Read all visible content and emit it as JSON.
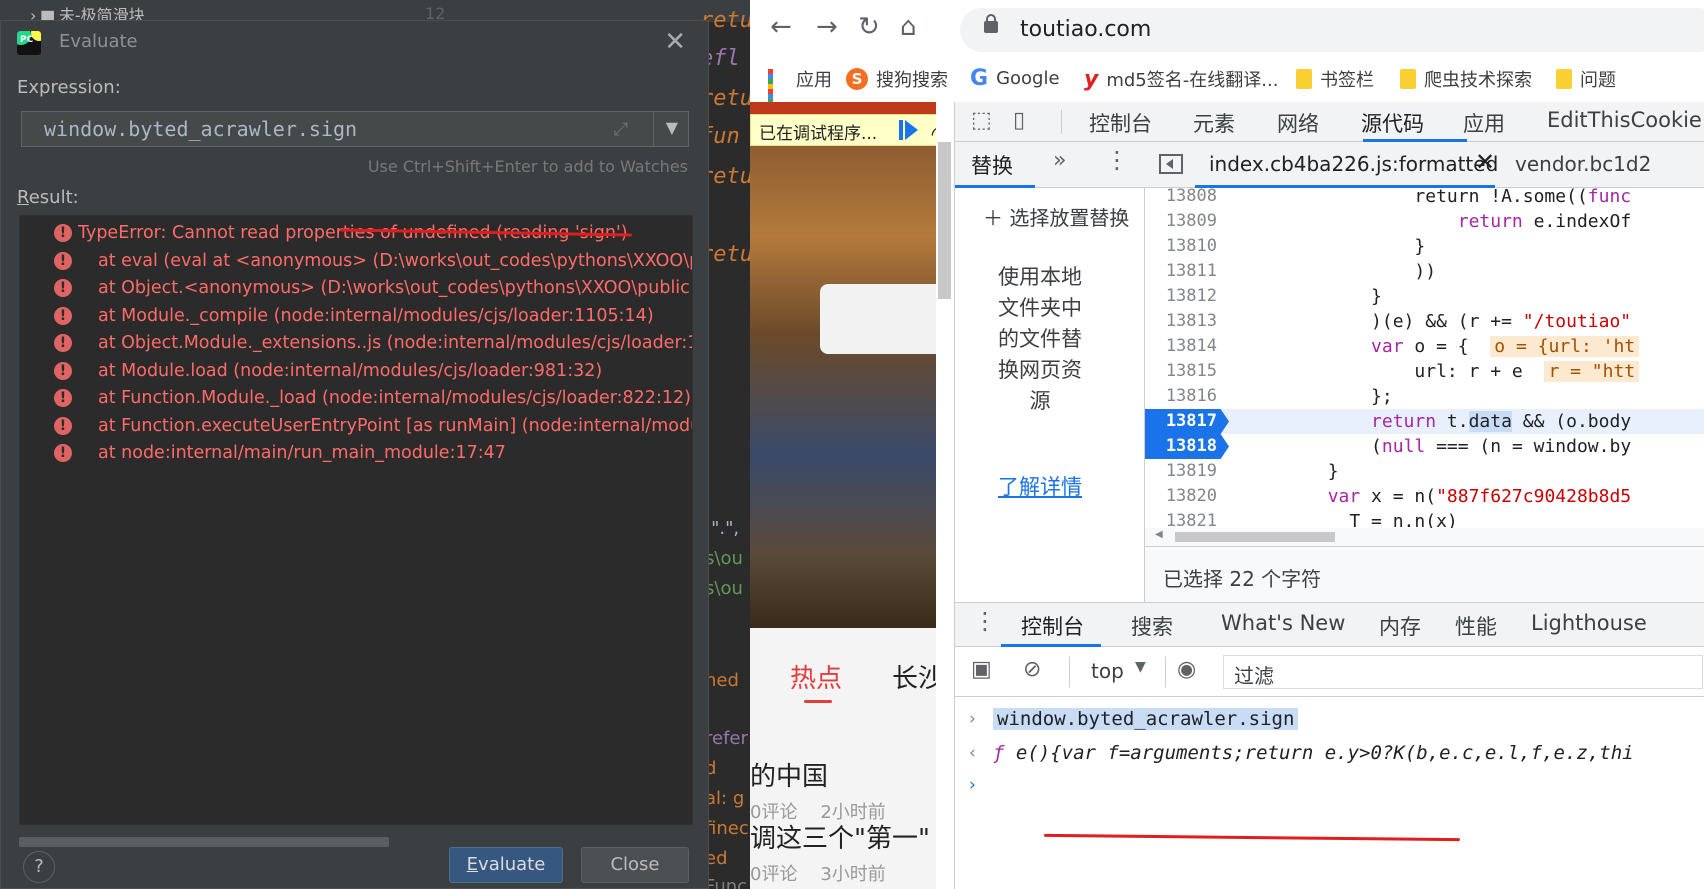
{
  "ide": {
    "tree_item": "未-极简滑块",
    "line_no": "12",
    "code_fragments": [
      "retu",
      "efl",
      "retu",
      "fun",
      "retu",
      "retu"
    ],
    "side_fragments": [
      ":\".\",",
      "s\\ou",
      "s\\ou",
      "ned",
      "refer",
      "d",
      "al: g",
      "finec",
      "ed",
      "Func"
    ]
  },
  "evaluate_dialog": {
    "title": "Evaluate",
    "logo_text": "PC",
    "expression_label": "Expression:",
    "expression_value": "window.byted_acrawler.sign",
    "watch_hint": "Use Ctrl+Shift+Enter to add to Watches",
    "result_label_first": "R",
    "result_label_rest": "esult:",
    "errors": [
      "TypeError: Cannot read properties of undefined (reading 'sign')",
      "at eval (eval at <anonymous> (D:\\works\\out_codes\\pythons\\XXOO\\p",
      "at Object.<anonymous> (D:\\works\\out_codes\\pythons\\XXOO\\public",
      "at Module._compile (node:internal/modules/cjs/loader:1105:14)",
      "at Object.Module._extensions..js (node:internal/modules/cjs/loader:1",
      "at Module.load (node:internal/modules/cjs/loader:981:32)",
      "at Function.Module._load (node:internal/modules/cjs/loader:822:12)",
      "at Function.executeUserEntryPoint [as runMain] (node:internal/modu",
      "at node:internal/main/run_main_module:17:47"
    ],
    "evaluate_label_first": "E",
    "evaluate_label_rest": "valuate",
    "close_label": "Close",
    "help_label": "?"
  },
  "browser": {
    "url": "toutiao.com",
    "bookmarks": [
      {
        "label": "应用",
        "icon": "apps-grid-icon"
      },
      {
        "label": "搜狗搜索",
        "icon": "sogou-icon"
      },
      {
        "label": "Google",
        "icon": "google-icon"
      },
      {
        "label": "md5签名-在线翻译...",
        "icon": "y-icon"
      },
      {
        "label": "书签栏",
        "icon": "folder-icon"
      },
      {
        "label": "爬虫技术探索",
        "icon": "folder-icon"
      },
      {
        "label": "问题",
        "icon": "folder-icon"
      }
    ],
    "page": {
      "debug_banner": "已在调试程序...",
      "tab_hot": "热点",
      "tab_second": "长沙",
      "news": [
        {
          "title": "调这三个\"第一\"",
          "comments": "0评论",
          "time": "3小时前"
        },
        {
          "title": "的中国",
          "comments": "0评论",
          "time": "2小时前"
        }
      ]
    }
  },
  "devtools": {
    "top_tabs": [
      "控制台",
      "元素",
      "网络",
      "源代码",
      "应用",
      "EditThisCookie"
    ],
    "active_top_tab": "源代码",
    "navigator": {
      "tab": "替换",
      "more": "»",
      "add_folder": "选择放置替换",
      "description": "使用本地文件夹中的文件替换网页资源",
      "learn_more": "了解详情"
    },
    "source_tabs": {
      "active_file": "index.cb4ba226.js:formatted",
      "other_file": "vendor.bc1d2"
    },
    "code_lines": [
      {
        "n": "13808",
        "parts": [
          {
            "t": "                return ",
            "c": ""
          },
          {
            "t": "!A.some((",
            "c": ""
          },
          {
            "t": "func",
            "c": "kw"
          }
        ]
      },
      {
        "n": "13809",
        "parts": [
          {
            "t": "                    ",
            "c": ""
          },
          {
            "t": "return",
            "c": "kw"
          },
          {
            "t": " e.indexOf",
            "c": ""
          }
        ]
      },
      {
        "n": "13810",
        "parts": [
          {
            "t": "                }",
            "c": ""
          }
        ]
      },
      {
        "n": "13811",
        "parts": [
          {
            "t": "                ))",
            "c": ""
          }
        ]
      },
      {
        "n": "13812",
        "parts": [
          {
            "t": "            }",
            "c": ""
          }
        ]
      },
      {
        "n": "13813",
        "parts": [
          {
            "t": "            )(e) && (r += ",
            "c": ""
          },
          {
            "t": "\"/toutiao\"",
            "c": "str"
          }
        ]
      },
      {
        "n": "13814",
        "parts": [
          {
            "t": "            ",
            "c": ""
          },
          {
            "t": "var",
            "c": "kw"
          },
          {
            "t": " o = {  ",
            "c": ""
          },
          {
            "t": "o = {url: 'ht",
            "c": "inl"
          }
        ]
      },
      {
        "n": "13815",
        "parts": [
          {
            "t": "                url: r + e  ",
            "c": ""
          },
          {
            "t": "r = \"htt",
            "c": "inl"
          }
        ]
      },
      {
        "n": "13816",
        "parts": [
          {
            "t": "            };",
            "c": ""
          }
        ]
      },
      {
        "n": "13817",
        "parts": [
          {
            "t": "            ",
            "c": ""
          },
          {
            "t": "return",
            "c": "kw"
          },
          {
            "t": " t.",
            "c": ""
          },
          {
            "t": "data",
            "c": "sel"
          },
          {
            "t": " && (o.body",
            "c": ""
          }
        ],
        "bp": true,
        "hl": true
      },
      {
        "n": "13818",
        "parts": [
          {
            "t": "            (",
            "c": ""
          },
          {
            "t": "null",
            "c": "kw"
          },
          {
            "t": " === (n = window.by",
            "c": ""
          }
        ],
        "bp": true
      },
      {
        "n": "13819",
        "parts": [
          {
            "t": "        }",
            "c": ""
          }
        ]
      },
      {
        "n": "13820",
        "parts": [
          {
            "t": "        ",
            "c": ""
          },
          {
            "t": "var",
            "c": "kw"
          },
          {
            "t": " x = n(",
            "c": ""
          },
          {
            "t": "\"887f627c90428b8d5",
            "c": "str"
          }
        ]
      },
      {
        "n": "13821",
        "parts": [
          {
            "t": "          T = n.n(x)",
            "c": ""
          }
        ]
      }
    ],
    "selection_status": "已选择 22 个字符",
    "drawer_tabs": [
      "控制台",
      "搜索",
      "What's New",
      "内存",
      "性能",
      "Lighthouse"
    ],
    "active_drawer_tab": "控制台",
    "console": {
      "context": "top",
      "filter_placeholder": "过滤",
      "input": "window.byted_acrawler.sign",
      "output_prefix": "ƒ",
      "output": " e(){var f=arguments;return e.y>0?K(b,e.c,e.l,f,e.z,thi"
    }
  },
  "colors": {
    "error_red": "#ff6b68",
    "annotation_red": "#e01e1e",
    "chrome_blue": "#1a73e8"
  }
}
